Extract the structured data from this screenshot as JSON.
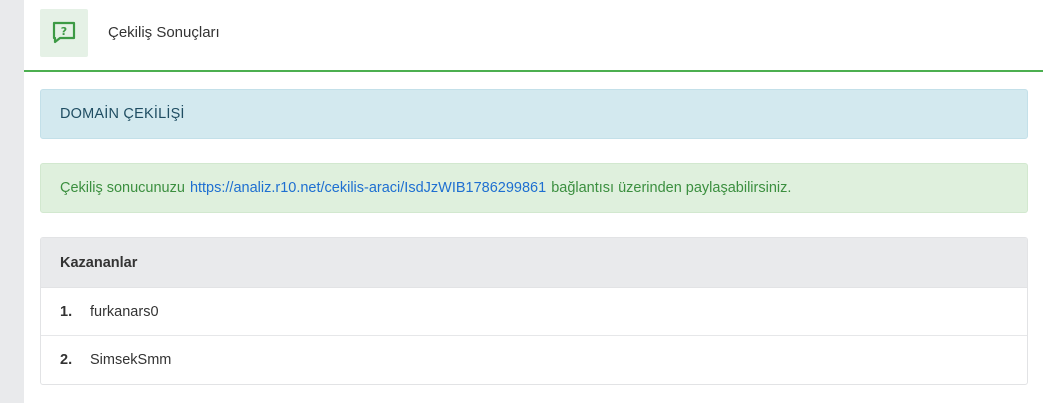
{
  "header": {
    "icon": "question-chat-icon",
    "title": "Çekiliş Sonuçları",
    "accent_color": "#4caf50"
  },
  "info_alert": {
    "text": "DOMAİN ÇEKİLİŞİ"
  },
  "success_alert": {
    "prefix": "Çekiliş sonucunuzu",
    "link": "https://analiz.r10.net/cekilis-araci/IsdJzWIB1786299861",
    "suffix": "bağlantısı üzerinden paylaşabilirsiniz."
  },
  "winners": {
    "title": "Kazananlar",
    "items": [
      {
        "rank": "1.",
        "name": "furkanars0"
      },
      {
        "rank": "2.",
        "name": "SimsekSmm"
      }
    ]
  }
}
